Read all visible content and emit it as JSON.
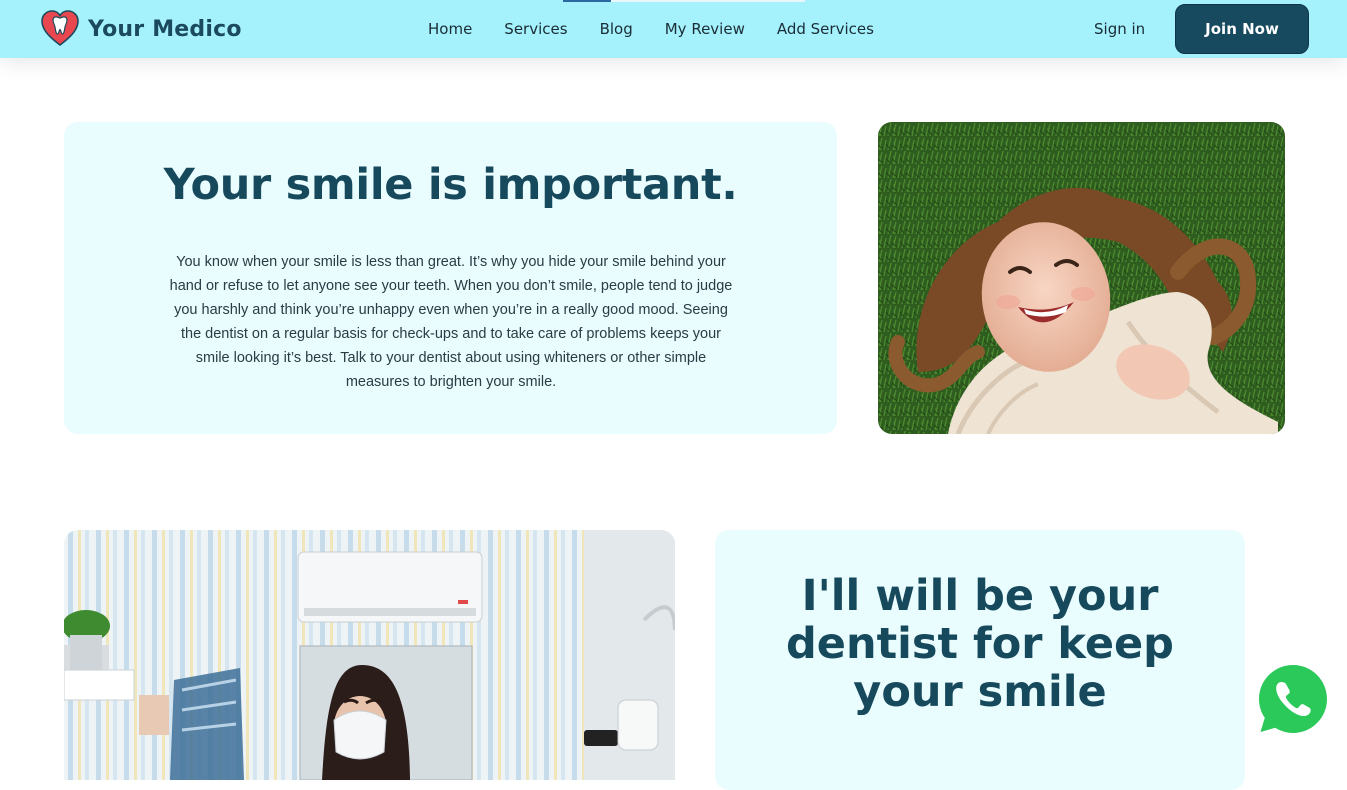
{
  "header": {
    "brand_name": "Your Medico",
    "nav": [
      {
        "label": "Home"
      },
      {
        "label": "Services"
      },
      {
        "label": "Blog"
      },
      {
        "label": "My Review"
      },
      {
        "label": "Add Services"
      }
    ],
    "sign_in": "Sign in",
    "join": "Join Now"
  },
  "hero": {
    "title": "Your smile is important.",
    "body": "You know when your smile is less than great. It’s why you hide your smile behind your hand or refuse to let anyone see your teeth. When you don’t smile, people tend to judge you harshly and think you’re unhappy even when you’re in a really good mood. Seeing the dentist on a regular basis for check-ups and to take care of problems keeps your smile looking it’s best. Talk to your dentist about using whiteners or other simple measures to brighten your smile."
  },
  "dentist_section": {
    "title": "I'll will be your dentist for keep your smile"
  },
  "icons": {
    "brand": "tooth-heart-icon",
    "whatsapp": "whatsapp-icon"
  },
  "colors": {
    "header_bg": "#a5f1fc",
    "accent": "#174a5f",
    "card_bg": "#e9fcfe",
    "whatsapp": "#25d366"
  }
}
